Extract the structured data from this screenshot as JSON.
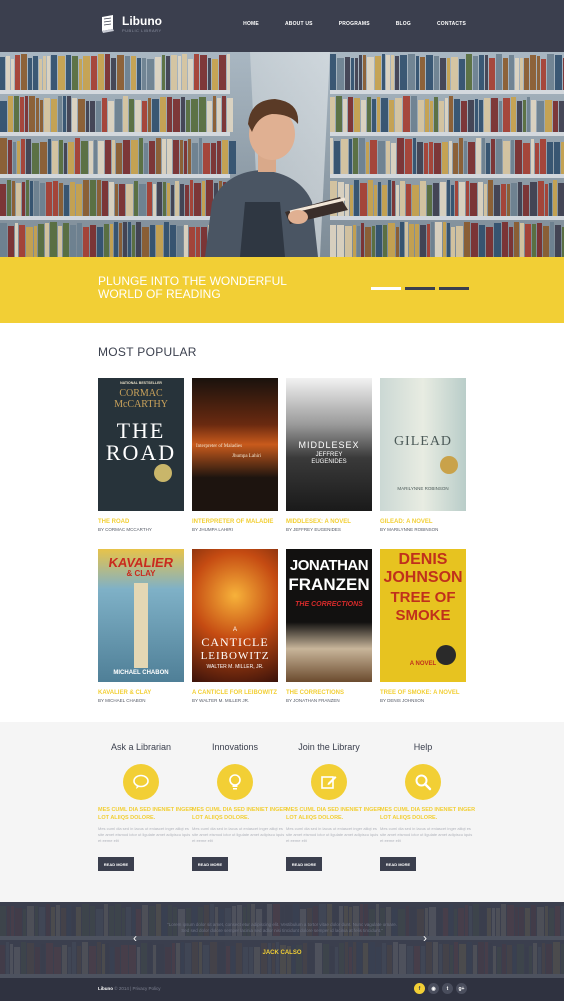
{
  "brand": {
    "name": "Libuno",
    "tagline": "PUBLIC LIBRARY"
  },
  "nav": {
    "items": [
      {
        "label": "HOME"
      },
      {
        "label": "ABOUT US"
      },
      {
        "label": "PROGRAMS"
      },
      {
        "label": "BLOG"
      },
      {
        "label": "CONTACTS"
      }
    ]
  },
  "hero": {
    "slogan": "PLUNGE INTO THE WONDERFUL WORLD OF READING",
    "slides": 3,
    "active_slide": 1
  },
  "popular": {
    "title": "MOST POPULAR",
    "books": [
      {
        "title": "THE ROAD",
        "author": "BY CORMAC MCCARTHY",
        "cover_lines": [
          "NATIONAL BESTSELLER",
          "CORMAC",
          "McCARTHY",
          "THE",
          "ROAD"
        ],
        "cover_bg": "#27333a"
      },
      {
        "title": "INTERPRETER OF MALADIE",
        "author": "BY JHUMPA LAHIRI",
        "cover_lines": [
          "Interpreter of Maladies",
          "Jhumpa Lahiri"
        ],
        "cover_bg": "#2a1c14"
      },
      {
        "title": "MIDDLESEX: A NOVEL",
        "author": "BY JEFFREY EUGENIDES",
        "cover_lines": [
          "MIDDLESEX",
          "JEFFREY",
          "EUGENIDES"
        ],
        "cover_bg": "#3a3a3a"
      },
      {
        "title": "GILEAD: A NOVEL",
        "author": "BY MARILYNNE ROBINSON",
        "cover_lines": [
          "GILEAD",
          "MARILYNNE ROBINSON"
        ],
        "cover_bg": "#cfdad6"
      },
      {
        "title": "KAVALIER & CLAY",
        "author": "BY MICHAEL CHABON",
        "cover_lines": [
          "KAVALIER",
          "& CLAY",
          "MICHAEL CHABON"
        ],
        "cover_bg": "#6c9cb6"
      },
      {
        "title": "A CANTICLE FOR LEIBOWITZ",
        "author": "BY WALTER M. MILLER JR.",
        "cover_lines": [
          "A",
          "CANTICLE",
          "LEIBOWITZ",
          "WALTER M. MILLER, JR."
        ],
        "cover_bg": "#8a2f0e"
      },
      {
        "title": "THE CORRECTIONS",
        "author": "BY JONATHAN FRANZEN",
        "cover_lines": [
          "JONATHAN",
          "FRANZEN",
          "THE CORRECTIONS"
        ],
        "cover_bg": "#1c1a18"
      },
      {
        "title": "TREE OF SMOKE: A NOVEL",
        "author": "BY DENIS JOHNSON",
        "cover_lines": [
          "DENIS",
          "JOHNSON",
          "TREE OF",
          "SMOKE",
          "A NOVEL"
        ],
        "cover_bg": "#e7c320"
      }
    ]
  },
  "features": [
    {
      "title": "Ask a Librarian",
      "icon": "chat-bubble-icon",
      "heading": "MES CUML DIA SED INENIET INGER LOT ALIIQS DOLORE.",
      "text": "Mes cuml dia sed in lacus ut eniascet inger aliiqt es site amet eismod ictor ut ligulate amet adipiscu iquis et eeme elit",
      "button": "READ MORE"
    },
    {
      "title": "Innovations",
      "icon": "lightbulb-icon",
      "heading": "MES CUML DIA SED INENIET INGER LOT ALIIQS DOLORE.",
      "text": "Mes cuml dia sed in lacus ut eniascet inger aliiqt es site amet eismod ictor ut ligulate amet adipiscu iquis et eeme elit",
      "button": "READ MORE"
    },
    {
      "title": "Join the Library",
      "icon": "edit-icon",
      "heading": "MES CUML DIA SED INENIET INGER LOT ALIIQS DOLORE.",
      "text": "Mes cuml dia sed in lacus ut eniascet inger aliiqt es site amet eismod ictor ut ligulate amet adipiscu iquis et eeme elit",
      "button": "READ MORE"
    },
    {
      "title": "Help",
      "icon": "search-icon",
      "heading": "MES CUML DIA SED INENIET INGER LOT ALIIQS DOLORE.",
      "text": "Mes cuml dia sed in lacus ut eniascet inger aliiqt es site amet eismod ictor ut ligulate amet adipiscu iquis et eeme elit",
      "button": "READ MORE"
    }
  ],
  "testimonial": {
    "quote": "\"Lorem ipsum dolor sit amet, consect etur adipiscing elit. Vestibulum a tortor vitae dolor dunt. Nunc vagulate ornare. Sed sed dolor dolore semper lacinia sed adlor nisi tincidunt dolore semper id lacinia at felis tincidunt.\"",
    "author": "JACK CALSO",
    "prev": "‹",
    "next": "›"
  },
  "footer": {
    "brand": "Libuno",
    "copyright": "© 2014 | Privacy Policy",
    "socials": [
      {
        "icon": "facebook-icon",
        "glyph": "f"
      },
      {
        "icon": "rss-icon",
        "glyph": "◉"
      },
      {
        "icon": "twitter-icon",
        "glyph": "t"
      },
      {
        "icon": "google-plus-icon",
        "glyph": "g+"
      }
    ]
  },
  "colors": {
    "accent": "#f2cf35",
    "dark": "#3b3f4e",
    "footer": "#2f3240"
  }
}
